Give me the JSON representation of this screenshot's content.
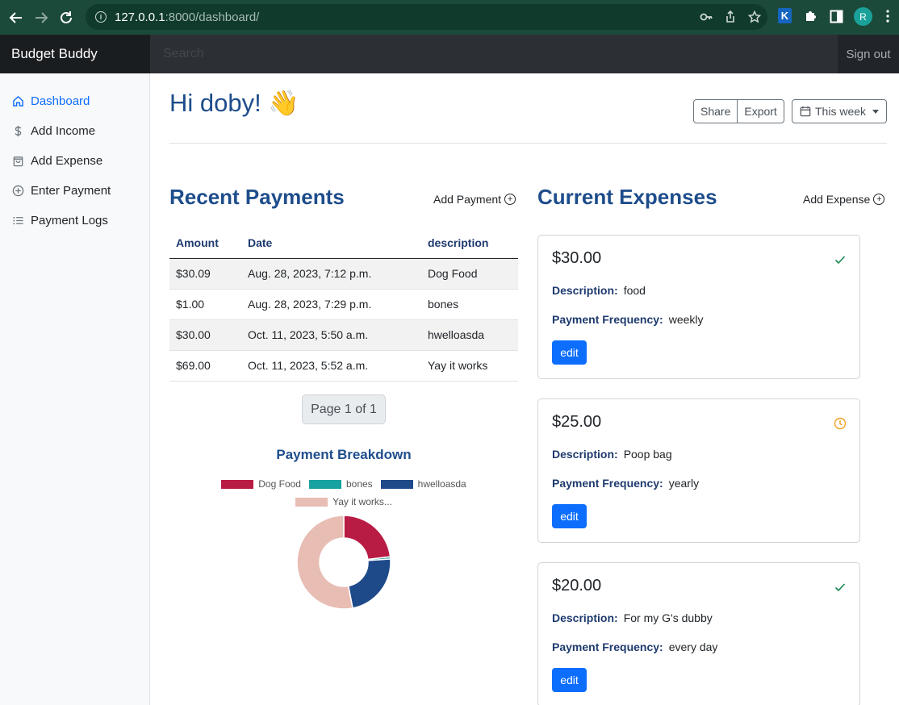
{
  "browser": {
    "url_host": "127.0.0.1",
    "url_rest": ":8000/dashboard/",
    "profile_initial": "R",
    "extension_letter": "K"
  },
  "navbar": {
    "brand": "Budget Buddy",
    "search_placeholder": "Search",
    "signout": "Sign out"
  },
  "sidebar": {
    "items": [
      {
        "label": "Dashboard",
        "icon": "house-icon"
      },
      {
        "label": "Add Income",
        "icon": "dollar-icon"
      },
      {
        "label": "Add Expense",
        "icon": "bag-icon"
      },
      {
        "label": "Enter Payment",
        "icon": "plus-circle-icon"
      },
      {
        "label": "Payment Logs",
        "icon": "list-icon"
      }
    ]
  },
  "header": {
    "greeting": "Hi doby! 👋",
    "share": "Share",
    "export": "Export",
    "period": "This week"
  },
  "payments": {
    "title": "Recent Payments",
    "add_label": "Add Payment",
    "columns": [
      "Amount",
      "Date",
      "description"
    ],
    "rows": [
      [
        "$30.09",
        "Aug. 28, 2023, 7:12 p.m.",
        "Dog Food"
      ],
      [
        "$1.00",
        "Aug. 28, 2023, 7:29 p.m.",
        "bones"
      ],
      [
        "$30.00",
        "Oct. 11, 2023, 5:50 a.m.",
        "hwelloasda"
      ],
      [
        "$69.00",
        "Oct. 11, 2023, 5:52 a.m.",
        "Yay it works"
      ]
    ],
    "pagination": "Page 1 of 1"
  },
  "chart_data": {
    "type": "pie",
    "title": "Payment Breakdown",
    "categories": [
      "Dog Food",
      "bones",
      "hwelloasda",
      "Yay it works..."
    ],
    "values": [
      30.09,
      1.0,
      30.0,
      69.0
    ],
    "colors": [
      "#b81c44",
      "#17a2a0",
      "#1f4a8a",
      "#e8bdb4"
    ],
    "legend": "top"
  },
  "expenses": {
    "title": "Current Expenses",
    "add_label": "Add Expense",
    "desc_key": "Description:",
    "freq_key": "Payment Frequency:",
    "edit_label": "edit",
    "cards": [
      {
        "amount": "$30.00",
        "description": "food",
        "frequency": "weekly",
        "status_icon": "check-icon",
        "status_color": "#198754"
      },
      {
        "amount": "$25.00",
        "description": "Poop bag",
        "frequency": "yearly",
        "status_icon": "clock-icon",
        "status_color": "#f0a020"
      },
      {
        "amount": "$20.00",
        "description": "For my G's dubby",
        "frequency": "every day",
        "status_icon": "check-icon",
        "status_color": "#198754"
      }
    ]
  }
}
